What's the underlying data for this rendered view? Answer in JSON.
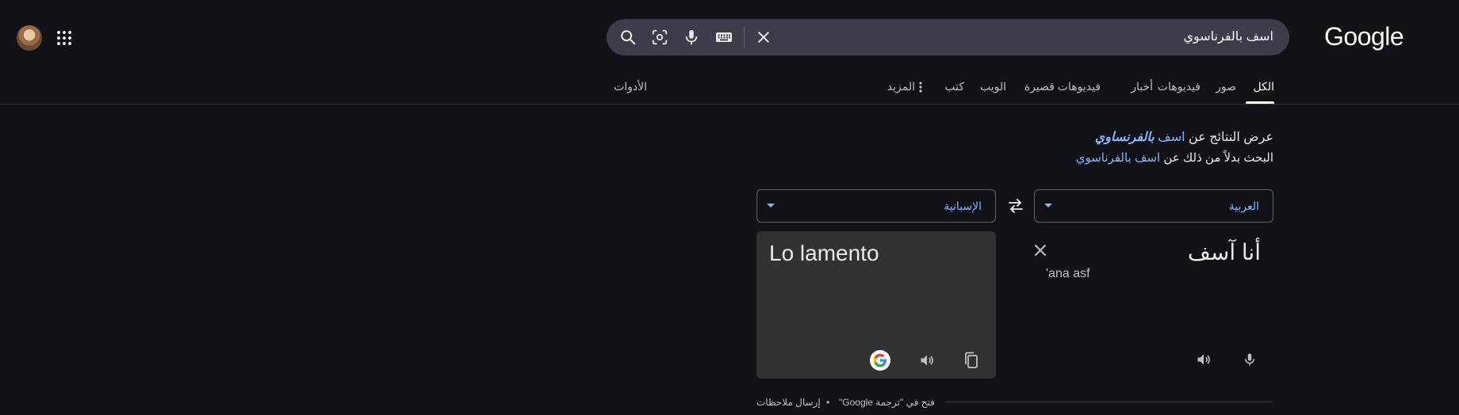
{
  "header": {
    "logo_text": "Google",
    "search": {
      "value": "اسف بالفرناسوي"
    },
    "icons": [
      "search-icon",
      "lens-icon",
      "mic-icon",
      "keyboard-icon",
      "close-icon",
      "apps-icon"
    ]
  },
  "tabs": [
    {
      "label": "الكل",
      "selected": true
    },
    {
      "label": "صور"
    },
    {
      "label": "فيديوهات"
    },
    {
      "label": "أخبار"
    },
    {
      "label": "فيديوهات قصيرة"
    },
    {
      "label": "الويب"
    },
    {
      "label": "كتب"
    },
    {
      "label": "المزيد"
    }
  ],
  "tools_label": "الأدوات",
  "spelling": {
    "showing_prefix": "عرض النتائج عن",
    "corrected_plain": "اسف",
    "corrected_emph": "بالفرنساوي",
    "instead_prefix": "البحث بدلاً من ذلك عن",
    "original_query": "اسف بالفرناسوي"
  },
  "translator": {
    "source_lang": "العربية",
    "target_lang": "الإسبانية",
    "source_text": "أنا آسف",
    "transliteration": "'ana asf",
    "output_text": "Lo lamento"
  },
  "footer": {
    "feedback": "إرسال ملاحظات",
    "separator": "•",
    "open_in": "فتح في \"ترجمة Google\""
  },
  "colors": {
    "background": "#101218",
    "link": "#8ab4f8",
    "search_bg": "#3b3e4a",
    "output_bg": "#303134"
  }
}
